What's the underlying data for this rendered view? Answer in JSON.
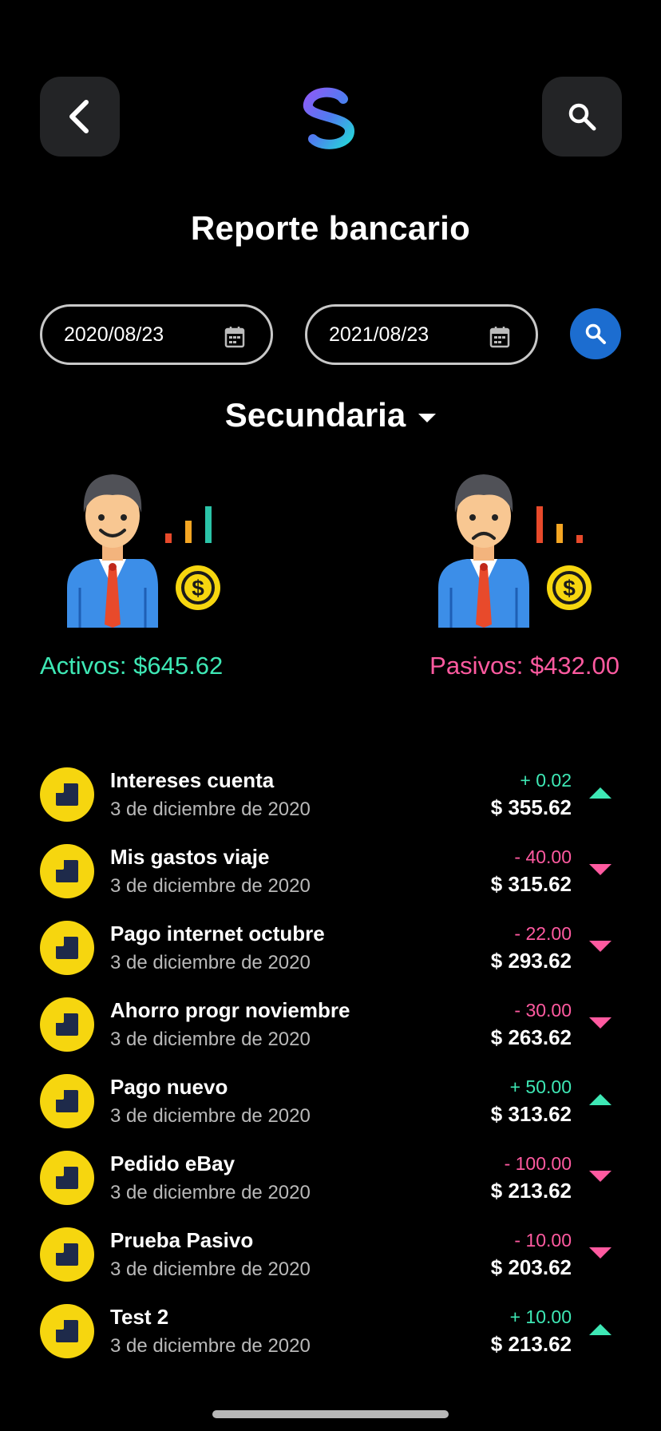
{
  "header": {
    "title": "Reporte bancario",
    "back_icon": "chevron-left-icon",
    "search_icon": "search-icon",
    "logo_icon": "dollar-s-logo"
  },
  "filters": {
    "date_from": "2020/08/23",
    "date_to": "2021/08/23",
    "calendar_icon": "calendar-icon",
    "search_icon": "search-icon",
    "search_button_color": "#1c6dd0"
  },
  "account": {
    "name": "Secundaria",
    "dropdown_icon": "caret-down-icon"
  },
  "summary": {
    "assets_label": "Activos: $645.62",
    "liabilities_label": "Pasivos: $432.00",
    "assets_color": "#3ee8b5",
    "liabilities_color": "#ff5aa0"
  },
  "transactions": [
    {
      "name": "Intereses cuenta",
      "date": "3 de diciembre de 2020",
      "amount": "+ 0.02",
      "balance": "$ 355.62",
      "direction": "up"
    },
    {
      "name": "Mis gastos viaje",
      "date": "3 de diciembre de 2020",
      "amount": "- 40.00",
      "balance": "$ 315.62",
      "direction": "down"
    },
    {
      "name": "Pago internet octubre",
      "date": "3 de diciembre de 2020",
      "amount": "- 22.00",
      "balance": "$ 293.62",
      "direction": "down"
    },
    {
      "name": "Ahorro progr noviembre",
      "date": "3 de diciembre de 2020",
      "amount": "- 30.00",
      "balance": "$ 263.62",
      "direction": "down"
    },
    {
      "name": "Pago nuevo",
      "date": "3 de diciembre de 2020",
      "amount": "+ 50.00",
      "balance": "$ 313.62",
      "direction": "up"
    },
    {
      "name": "Pedido eBay",
      "date": "3 de diciembre de 2020",
      "amount": "- 100.00",
      "balance": "$ 213.62",
      "direction": "down"
    },
    {
      "name": "Prueba Pasivo",
      "date": "3 de diciembre de 2020",
      "amount": "- 10.00",
      "balance": "$ 203.62",
      "direction": "down"
    },
    {
      "name": "Test 2",
      "date": "3 de diciembre de 2020",
      "amount": "+ 10.00",
      "balance": "$ 213.62",
      "direction": "up"
    }
  ]
}
